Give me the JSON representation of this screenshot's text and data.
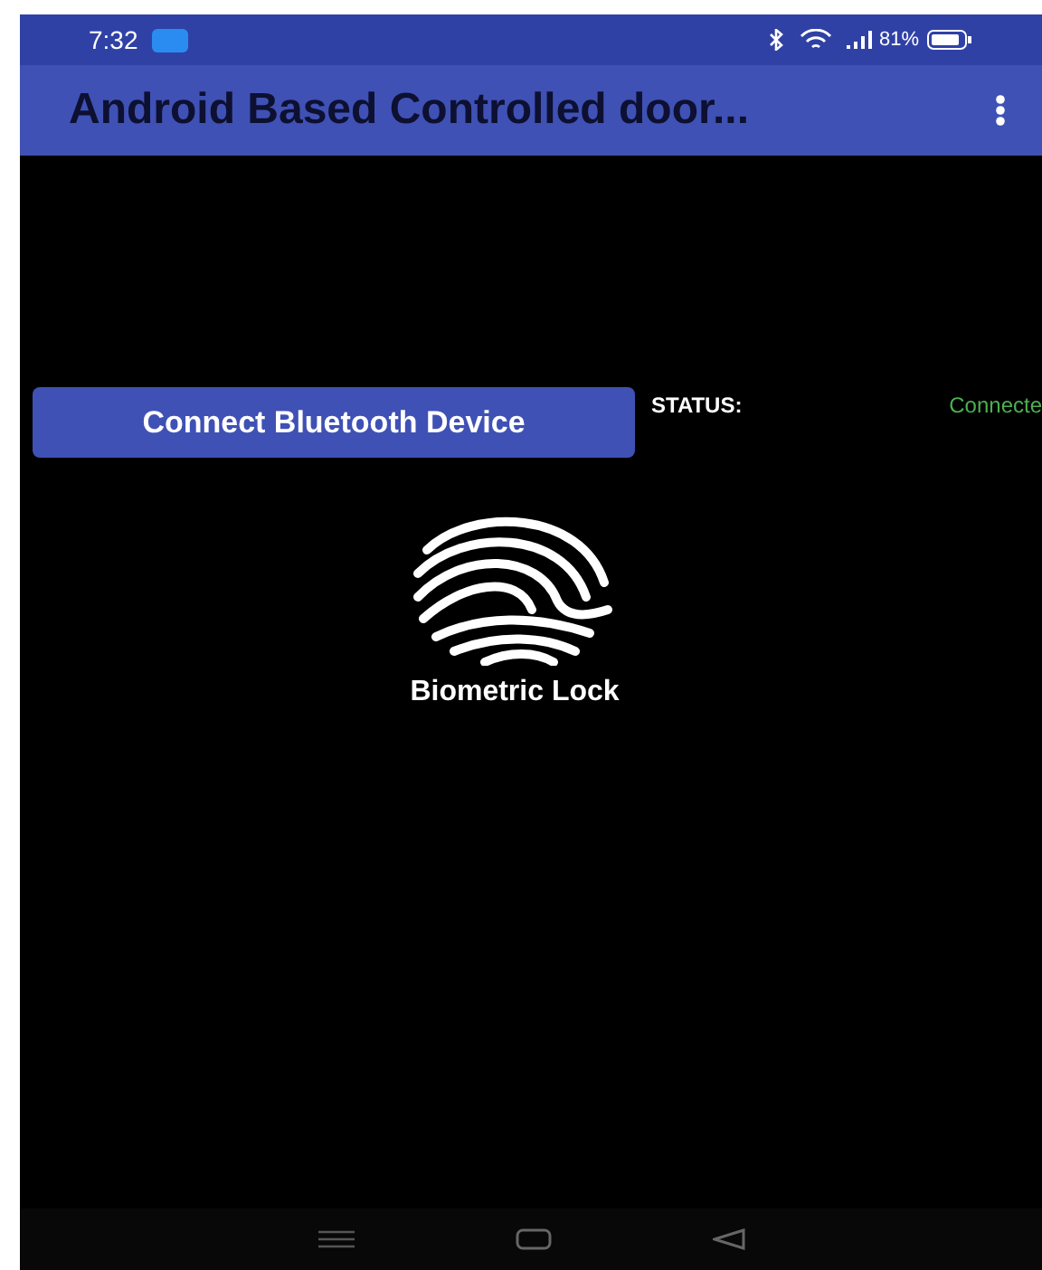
{
  "status_bar": {
    "time": "7:32",
    "battery": "81%"
  },
  "app_bar": {
    "title": "Android Based Controlled door..."
  },
  "connect_button": {
    "label": "Connect Bluetooth Device"
  },
  "status": {
    "label": "STATUS:",
    "value": "Connecte"
  },
  "biometric": {
    "label": "Biometric Lock"
  }
}
